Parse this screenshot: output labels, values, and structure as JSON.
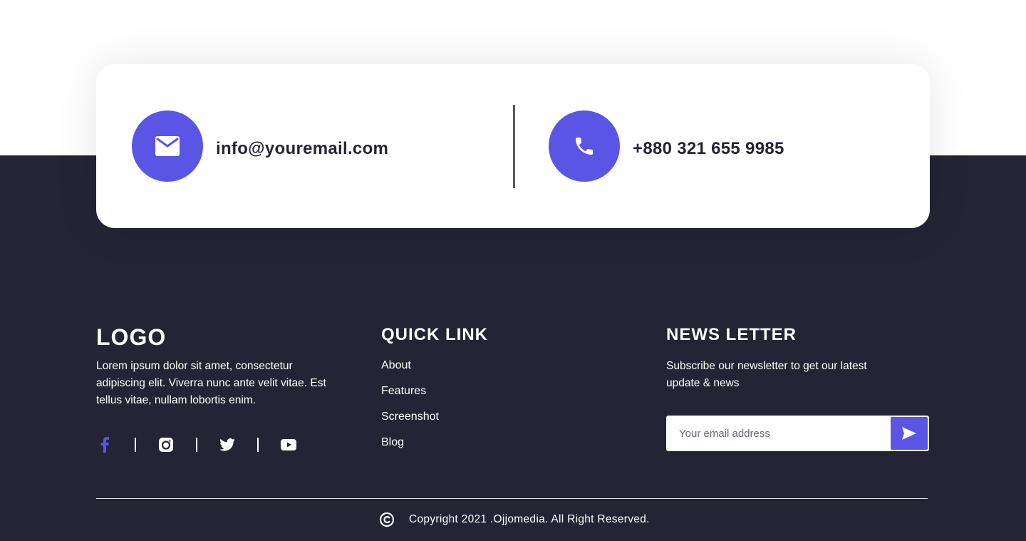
{
  "contact": {
    "email": "info@youremail.com",
    "phone": "+880 321 655 9985"
  },
  "footer": {
    "logo": "LOGO",
    "about": "Lorem ipsum dolor sit amet, consectetur adipiscing elit. Viverra nunc ante velit vitae. Est tellus vitae, nullam lobortis enim.",
    "socials": [
      {
        "name": "facebook-icon",
        "color": "#5b55e6"
      },
      {
        "name": "instagram-icon",
        "color": "#ffffff"
      },
      {
        "name": "twitter-icon",
        "color": "#ffffff"
      },
      {
        "name": "youtube-icon",
        "color": "#ffffff"
      }
    ],
    "quick_link": {
      "title": "QUICK LINK",
      "links": [
        "About",
        "Features",
        "Screenshot",
        "Blog"
      ]
    },
    "newsletter": {
      "title": "NEWS LETTER",
      "text": "Subscribe our newsletter to get our latest update & news",
      "placeholder": "Your email address"
    },
    "copyright": "Copyright 2021 .Ojjomedia. All Right Reserved."
  },
  "colors": {
    "accent": "#5b55e6",
    "footer_bg": "#252436",
    "card_bg": "#ffffff"
  }
}
